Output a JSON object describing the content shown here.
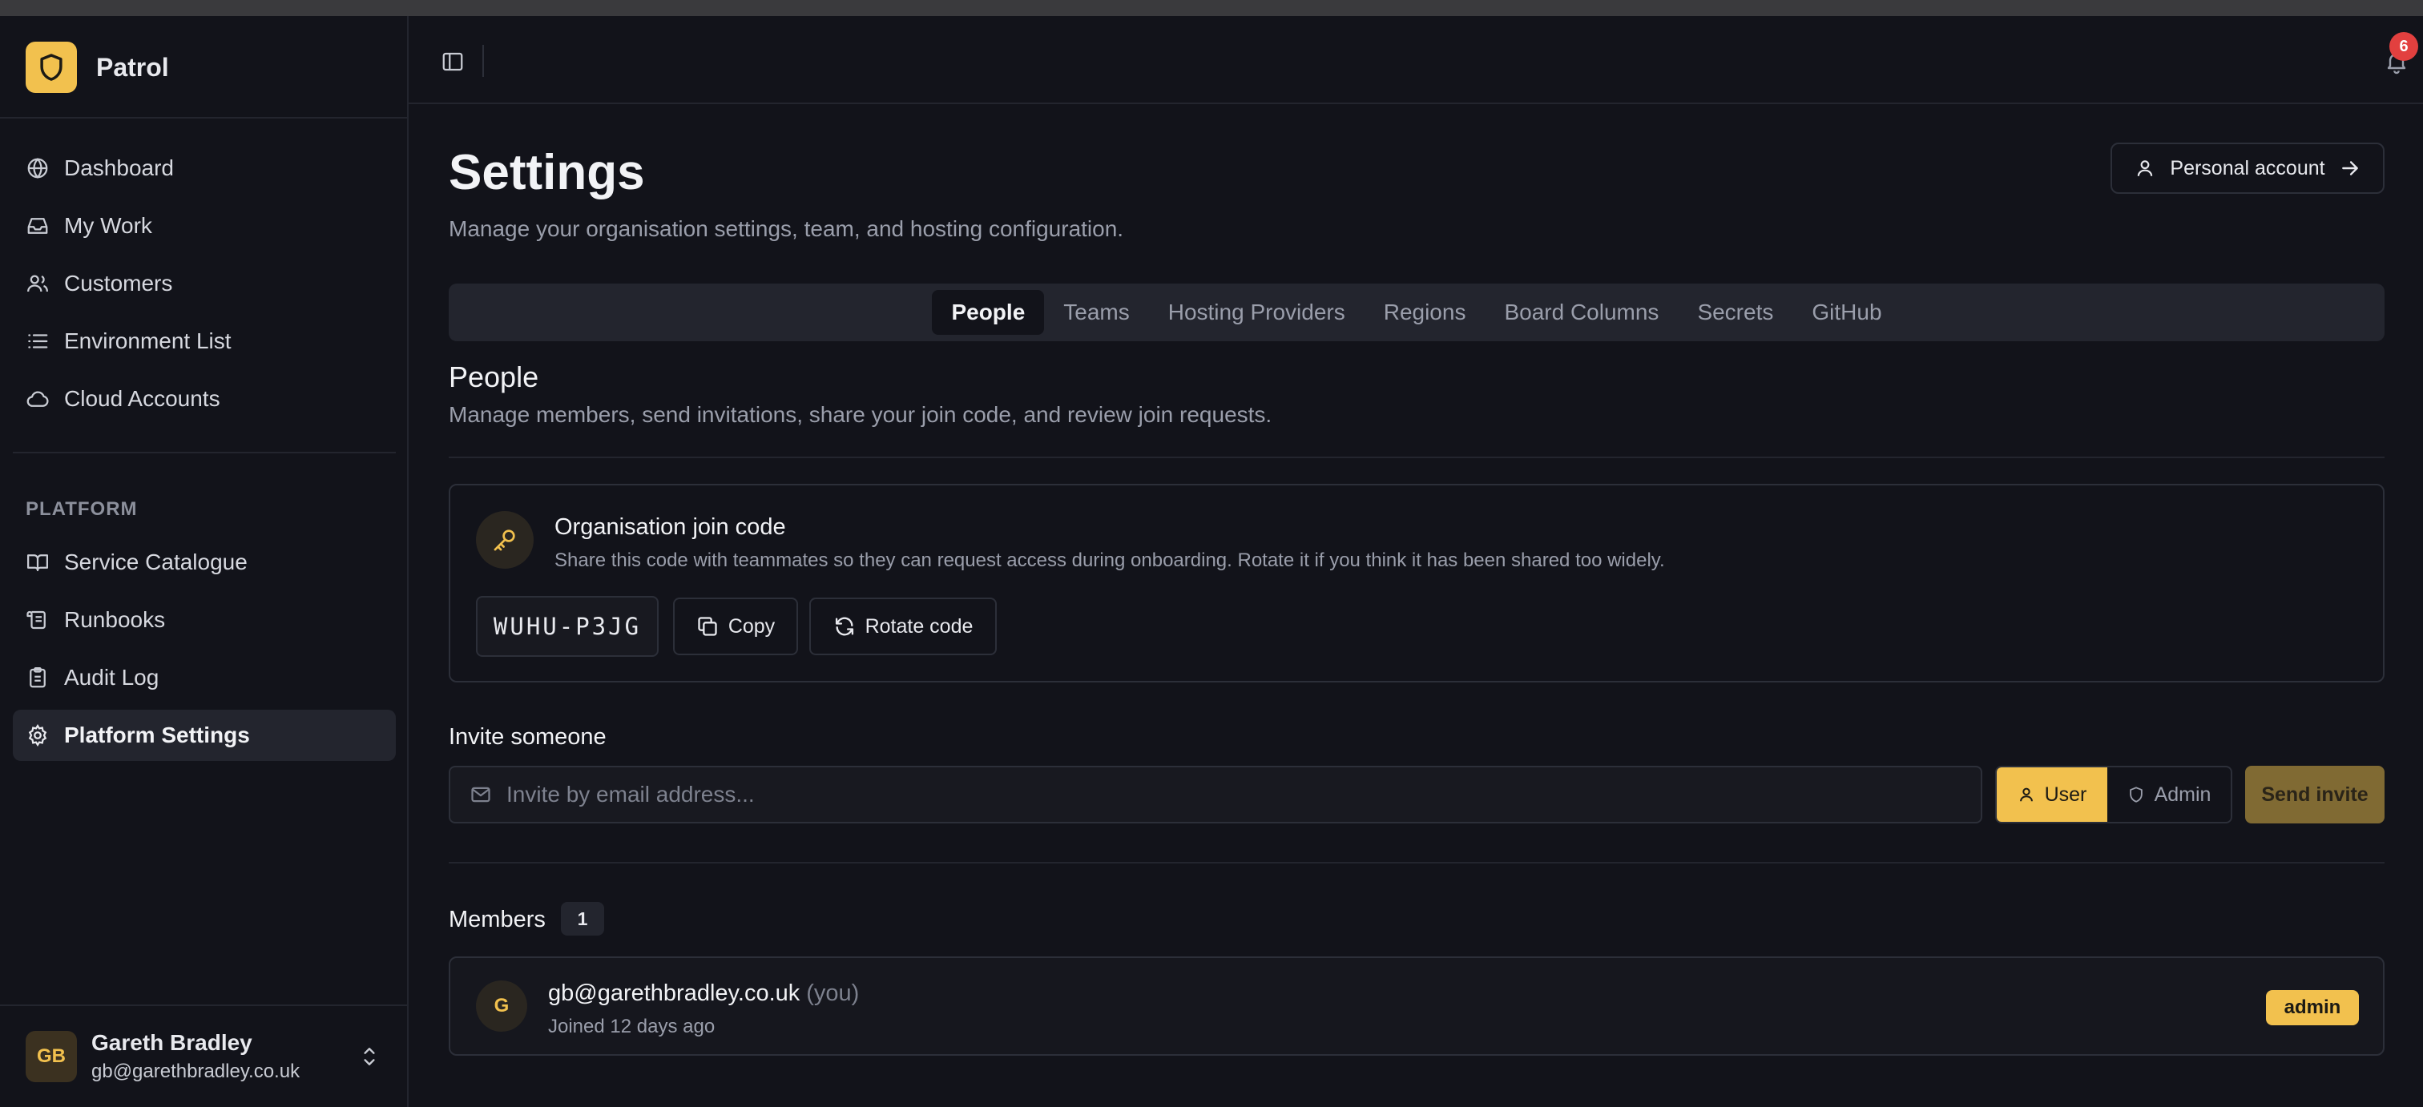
{
  "app": {
    "name": "Patrol"
  },
  "sidebar": {
    "items": [
      {
        "label": "Dashboard",
        "icon": "globe-icon"
      },
      {
        "label": "My Work",
        "icon": "inbox-icon"
      },
      {
        "label": "Customers",
        "icon": "users-icon"
      },
      {
        "label": "Environment List",
        "icon": "list-icon"
      },
      {
        "label": "Cloud Accounts",
        "icon": "cloud-icon"
      }
    ],
    "section_label": "PLATFORM",
    "platform_items": [
      {
        "label": "Service Catalogue",
        "icon": "book-icon"
      },
      {
        "label": "Runbooks",
        "icon": "scroll-icon"
      },
      {
        "label": "Audit Log",
        "icon": "clipboard-icon"
      },
      {
        "label": "Platform Settings",
        "icon": "gear-icon",
        "active": true
      }
    ],
    "user": {
      "initials": "GB",
      "name": "Gareth Bradley",
      "email": "gb@garethbradley.co.uk"
    }
  },
  "header": {
    "notification_count": "6"
  },
  "page": {
    "title": "Settings",
    "subtitle": "Manage your organisation settings, team, and hosting configuration.",
    "personal_account_label": "Personal account"
  },
  "tabs": [
    {
      "label": "People",
      "active": true
    },
    {
      "label": "Teams"
    },
    {
      "label": "Hosting Providers"
    },
    {
      "label": "Regions"
    },
    {
      "label": "Board Columns"
    },
    {
      "label": "Secrets"
    },
    {
      "label": "GitHub"
    }
  ],
  "people": {
    "title": "People",
    "description": "Manage members, send invitations, share your join code, and review join requests.",
    "join_code": {
      "title": "Organisation join code",
      "description": "Share this code with teammates so they can request access during onboarding. Rotate it if you think it has been shared too widely.",
      "code": "WUHU-P3JG",
      "copy_label": "Copy",
      "rotate_label": "Rotate code"
    },
    "invite": {
      "label": "Invite someone",
      "placeholder": "Invite by email address...",
      "value": "",
      "role_user": "User",
      "role_admin": "Admin",
      "selected_role": "User",
      "send_label": "Send invite"
    },
    "members": {
      "label": "Members",
      "count": "1",
      "rows": [
        {
          "initial": "G",
          "email": "gb@garethbradley.co.uk",
          "you": "(you)",
          "joined": "Joined 12 days ago",
          "role": "admin"
        }
      ]
    }
  },
  "colors": {
    "accent": "#f2c14e",
    "background": "#12131a",
    "surface": "#23252e",
    "badge": "#e2403f"
  }
}
